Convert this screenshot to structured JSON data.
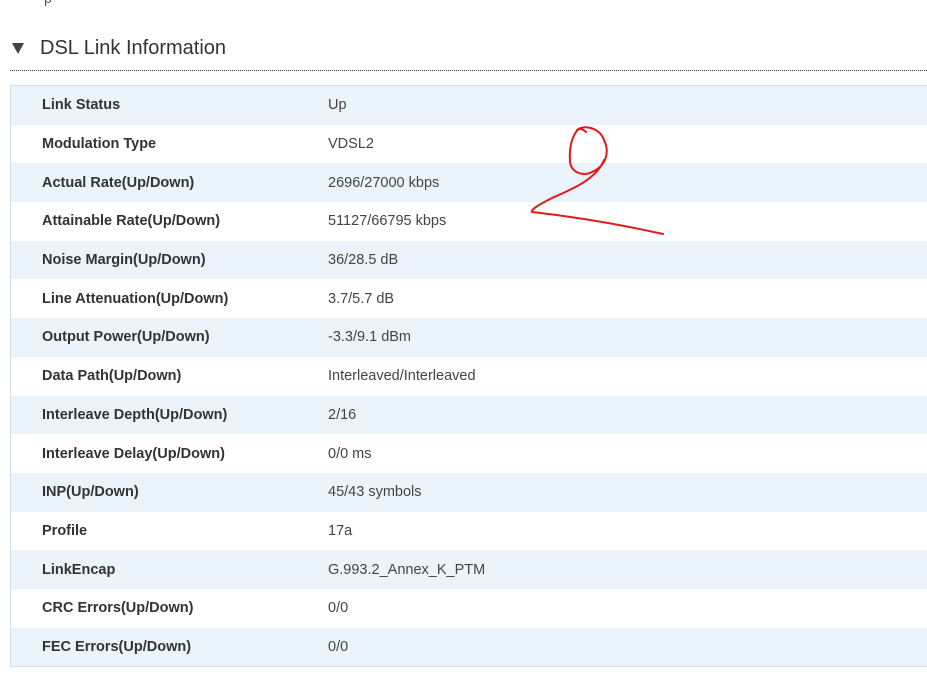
{
  "section": {
    "title": "DSL Link Information",
    "top_remnant": "p"
  },
  "annotation": {
    "handwritten_mark": "2",
    "ink_color": "#e01b1b"
  },
  "rows": [
    {
      "label": "Link Status",
      "value": "Up"
    },
    {
      "label": "Modulation Type",
      "value": "VDSL2"
    },
    {
      "label": "Actual Rate(Up/Down)",
      "value": "2696/27000 kbps"
    },
    {
      "label": "Attainable Rate(Up/Down)",
      "value": "51127/66795 kbps"
    },
    {
      "label": "Noise Margin(Up/Down)",
      "value": "36/28.5 dB"
    },
    {
      "label": "Line Attenuation(Up/Down)",
      "value": "3.7/5.7 dB"
    },
    {
      "label": "Output Power(Up/Down)",
      "value": "-3.3/9.1 dBm"
    },
    {
      "label": "Data Path(Up/Down)",
      "value": "Interleaved/Interleaved"
    },
    {
      "label": "Interleave Depth(Up/Down)",
      "value": "2/16"
    },
    {
      "label": "Interleave Delay(Up/Down)",
      "value": "0/0 ms"
    },
    {
      "label": "INP(Up/Down)",
      "value": "45/43 symbols"
    },
    {
      "label": "Profile",
      "value": "17a"
    },
    {
      "label": "LinkEncap",
      "value": "G.993.2_Annex_K_PTM"
    },
    {
      "label": "CRC Errors(Up/Down)",
      "value": "0/0"
    },
    {
      "label": "FEC Errors(Up/Down)",
      "value": "0/0"
    }
  ]
}
